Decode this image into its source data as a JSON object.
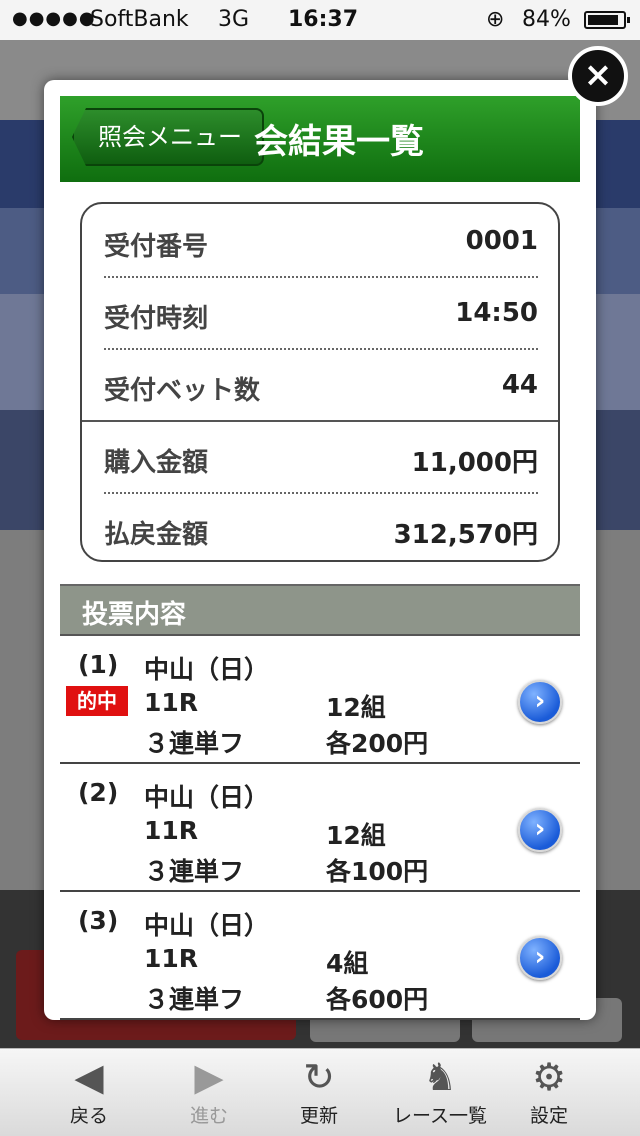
{
  "status_bar": {
    "signal": "●●●●●",
    "carrier": "SoftBank",
    "network": "3G",
    "time": "16:37",
    "battery": "84%"
  },
  "modal": {
    "back_label": "照会メニュー",
    "title": "会結果一覧",
    "summary": [
      {
        "label": "受付番号",
        "value": "0001"
      },
      {
        "label": "受付時刻",
        "value": "14:50"
      },
      {
        "label": "受付ベット数",
        "value": "44"
      },
      {
        "label": "購入金額",
        "value": "11,000円"
      },
      {
        "label": "払戻金額",
        "value": "312,570円"
      }
    ],
    "section_title": "投票内容",
    "items": [
      {
        "index": "(1)",
        "venue": "中山（日）",
        "race": "11R",
        "combos": "12組",
        "bet_type": "３連単フ",
        "each": "各200円",
        "badge": "的中"
      },
      {
        "index": "(2)",
        "venue": "中山（日）",
        "race": "11R",
        "combos": "12組",
        "bet_type": "３連単フ",
        "each": "各100円"
      },
      {
        "index": "(3)",
        "venue": "中山（日）",
        "race": "11R",
        "combos": "4組",
        "bet_type": "３連単フ",
        "each": "各600円"
      }
    ]
  },
  "close_label": "×",
  "toolbar": {
    "items": [
      {
        "icon": "back-icon",
        "label": "戻る"
      },
      {
        "icon": "forward-icon",
        "label": "進む"
      },
      {
        "icon": "refresh-icon",
        "label": "更新"
      },
      {
        "icon": "race-list-icon",
        "label": "レース一覧"
      },
      {
        "icon": "gear-icon",
        "label": "設定"
      }
    ]
  },
  "colors": {
    "header_green": "#1f8a1c",
    "hit_red": "#e01010",
    "arrow_blue": "#1a5bd8",
    "section_gray": "#8e958a"
  }
}
